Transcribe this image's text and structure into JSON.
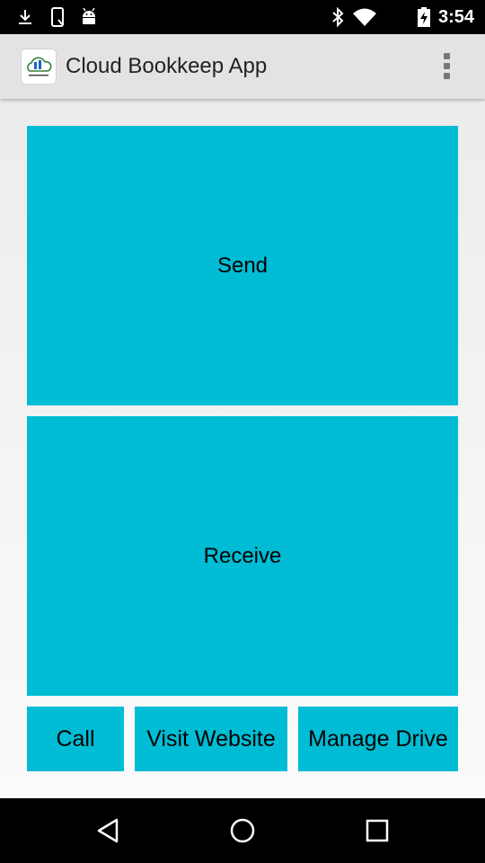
{
  "status_bar": {
    "time": "3:54",
    "left_icons": [
      "download-icon",
      "phone-icon",
      "android-icon"
    ],
    "right_icons": [
      "bluetooth-icon",
      "wifi-icon",
      "battery-charging-icon"
    ]
  },
  "action_bar": {
    "title": "Cloud Bookkeep App",
    "logo_icon": "cloud-bookkeeping-logo",
    "overflow_icon": "more-vert-icon"
  },
  "buttons": {
    "send": "Send",
    "receive": "Receive",
    "call": "Call",
    "visit_website": "Visit Website",
    "manage_drive": "Manage Drive"
  },
  "nav_bar": {
    "back_icon": "back-icon",
    "home_icon": "home-icon",
    "recents_icon": "recents-icon"
  },
  "colors": {
    "tile": "#00bcd4",
    "action_bar": "#e3e3e3",
    "background": "#f5f5f5",
    "system_bars": "#000000"
  }
}
